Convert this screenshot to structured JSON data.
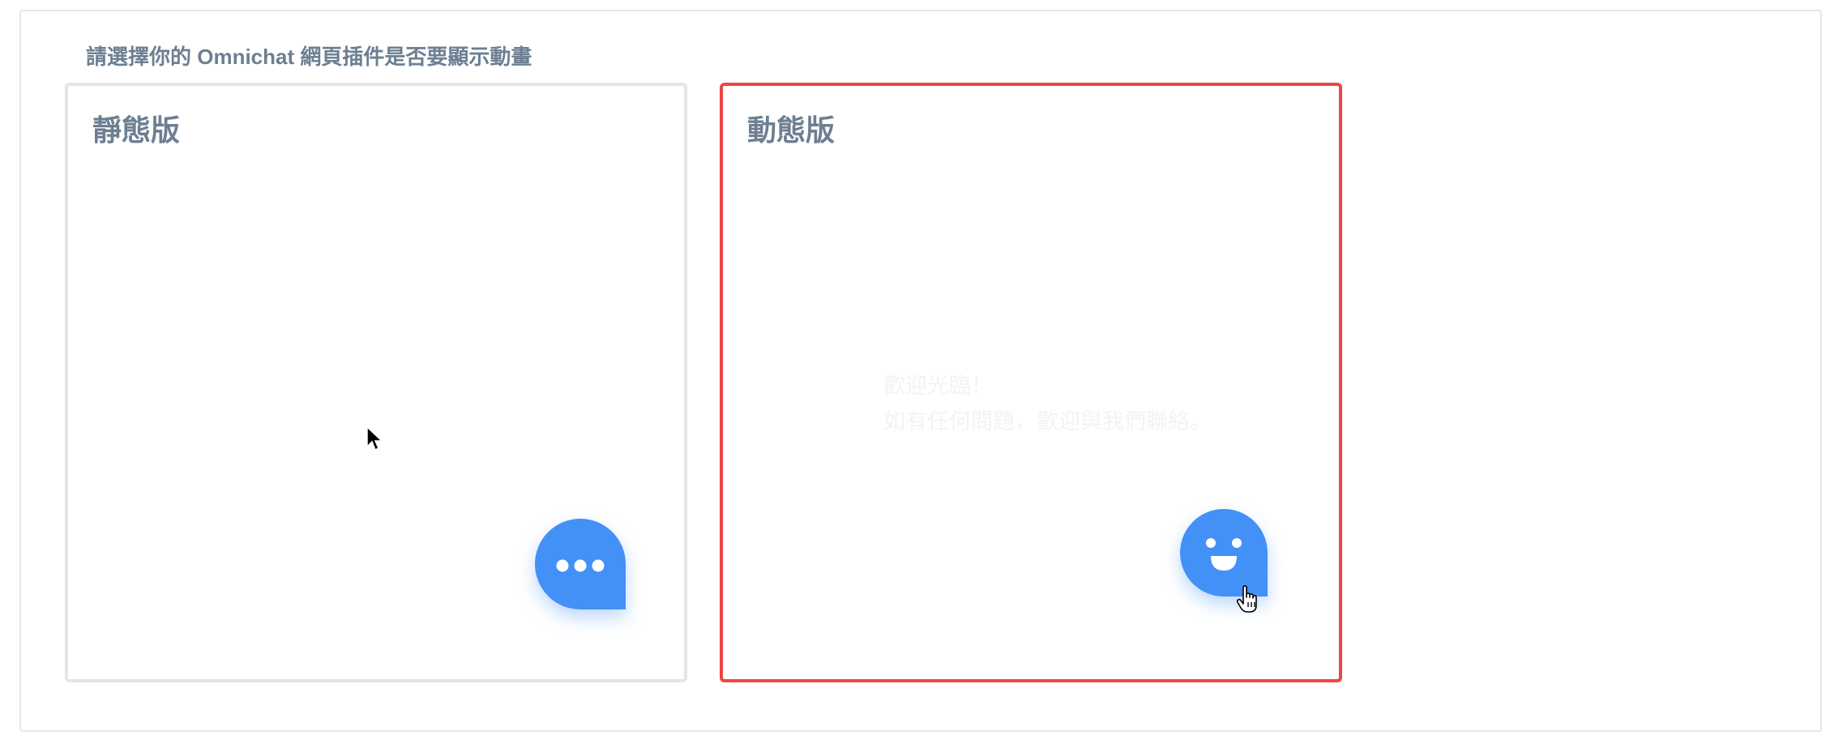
{
  "panel": {
    "title": "請選擇你的 Omnichat 網頁插件是否要顯示動畫"
  },
  "options": {
    "static": {
      "title": "靜態版",
      "icon": "chat-dots-icon"
    },
    "animated": {
      "title": "動態版",
      "icon": "chat-smile-icon",
      "welcome_line1": "歡迎光臨！",
      "welcome_line2": "如有任何問題，歡迎與我們聯絡。"
    }
  },
  "colors": {
    "selected_border": "#ec4646",
    "unselected_border": "#e5e5e5",
    "bubble": "#4390f7",
    "title_text": "#6d7f92"
  }
}
